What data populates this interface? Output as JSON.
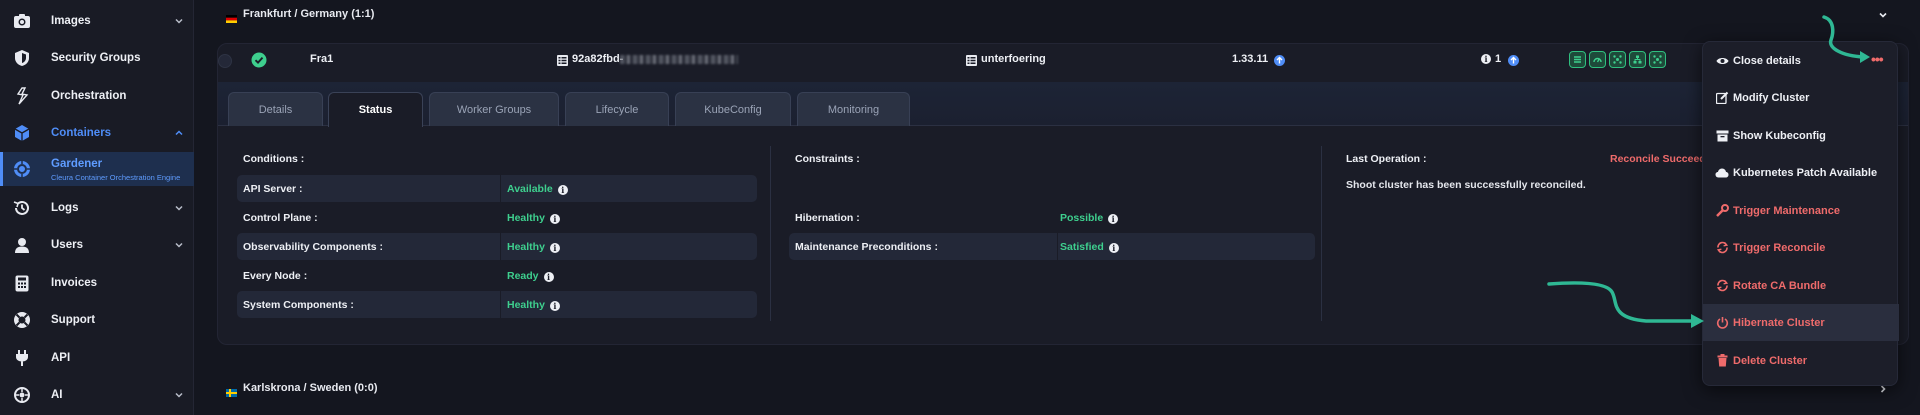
{
  "sidebar": {
    "items": [
      {
        "label": "Images",
        "icon": "camera-icon",
        "chevron": true
      },
      {
        "label": "Security Groups",
        "icon": "shield-icon",
        "chevron": false
      },
      {
        "label": "Orchestration",
        "icon": "orchestration-icon",
        "chevron": false
      },
      {
        "label": "Containers",
        "icon": "cube-icon",
        "chevron": true
      },
      {
        "label": "Gardener",
        "sublabel": "Cleura Container Orchestration Engine",
        "icon": "gardener-icon"
      },
      {
        "label": "Logs",
        "icon": "history-icon",
        "chevron": true
      },
      {
        "label": "Users",
        "icon": "user-icon",
        "chevron": true
      },
      {
        "label": "Invoices",
        "icon": "calculator-icon",
        "chevron": false
      },
      {
        "label": "Support",
        "icon": "lifebuoy-icon",
        "chevron": false
      },
      {
        "label": "API",
        "icon": "plug-icon",
        "chevron": false
      },
      {
        "label": "AI",
        "icon": "ai-icon",
        "chevron": true
      }
    ]
  },
  "regions": [
    {
      "label": "Frankfurt / Germany (1:1)",
      "flag": "germany-flag"
    },
    {
      "label": "Karlskrona / Sweden (0:0)",
      "flag": "sweden-flag"
    }
  ],
  "cluster": {
    "name": "Fra1",
    "id": "92a82fbd-",
    "project": "unterfoering",
    "version": "1.33.11",
    "alerts": "1"
  },
  "tabs": [
    "Details",
    "Status",
    "Worker Groups",
    "Lifecycle",
    "KubeConfig",
    "Monitoring"
  ],
  "status": {
    "conditions_title": "Conditions :",
    "conditions": [
      {
        "key": "API Server :",
        "value": "Available"
      },
      {
        "key": "Control Plane :",
        "value": "Healthy"
      },
      {
        "key": "Observability Components :",
        "value": "Healthy"
      },
      {
        "key": "Every Node :",
        "value": "Ready"
      },
      {
        "key": "System Components :",
        "value": "Healthy"
      }
    ],
    "constraints_title": "Constraints :",
    "constraints": [
      {
        "key": "Hibernation :",
        "value": "Possible"
      },
      {
        "key": "Maintenance Preconditions :",
        "value": "Satisfied"
      }
    ],
    "last_operation_title": "Last Operation :",
    "last_operation_status": "Reconcile Succeeded",
    "last_operation_message": "Shoot cluster has been successfully reconciled."
  },
  "menu": {
    "items": [
      {
        "label": "Close details",
        "icon": "eye-icon",
        "danger": false
      },
      {
        "label": "Modify Cluster",
        "icon": "edit-icon",
        "danger": false
      },
      {
        "label": "Show Kubeconfig",
        "icon": "archive-icon",
        "danger": false
      },
      {
        "label": "Kubernetes Patch Available",
        "icon": "cloud-icon",
        "danger": false
      },
      {
        "label": "Trigger Maintenance",
        "icon": "wrench-icon",
        "danger": true
      },
      {
        "label": "Trigger Reconcile",
        "icon": "refresh-icon",
        "danger": true
      },
      {
        "label": "Rotate CA Bundle",
        "icon": "rotate-icon",
        "danger": true
      },
      {
        "label": "Hibernate Cluster",
        "icon": "power-icon",
        "danger": true
      },
      {
        "label": "Delete Cluster",
        "icon": "trash-icon",
        "danger": true
      }
    ],
    "more_icon": "more-dots-icon"
  },
  "colors": {
    "accent": "#4f8df7",
    "success": "#3ecf8e",
    "danger": "#ef6b6b",
    "annotation_arrow": "#2fb894"
  }
}
